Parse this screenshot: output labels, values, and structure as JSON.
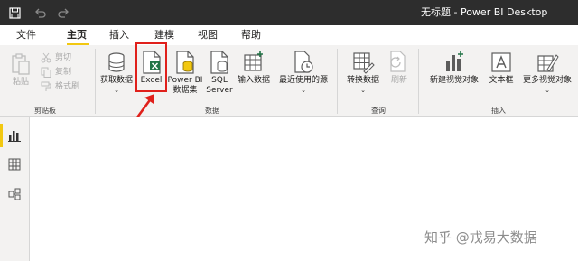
{
  "app": {
    "title": "无标题 - Power BI Desktop"
  },
  "menu": {
    "items": [
      "文件",
      "主页",
      "插入",
      "建模",
      "视图",
      "帮助"
    ],
    "active": "主页"
  },
  "clipboard": {
    "paste": "粘贴",
    "cut": "剪切",
    "copy": "复制",
    "format_painter": "格式刷",
    "group": "剪贴板"
  },
  "data_group": {
    "get_data": "获取数据",
    "excel": "Excel",
    "powerbi_line1": "Power BI",
    "powerbi_line2": "数据集",
    "sql_line1": "SQL",
    "sql_line2": "Server",
    "enter_data": "输入数据",
    "recent_sources": "最近使用的源",
    "group": "数据"
  },
  "query_group": {
    "transform": "转换数据",
    "refresh": "刷新",
    "group": "查询"
  },
  "insert_group": {
    "new_visual": "新建视觉对象",
    "text_box": "文本框",
    "more_visuals": "更多视觉对象",
    "group": "插入"
  },
  "watermark": "知乎 @戎易大数据",
  "colors": {
    "titlebar": "#2d2d2d",
    "ribbon": "#f3f2f1",
    "accent": "#f2c811",
    "highlight": "#e0201b",
    "excel_green": "#217346"
  }
}
